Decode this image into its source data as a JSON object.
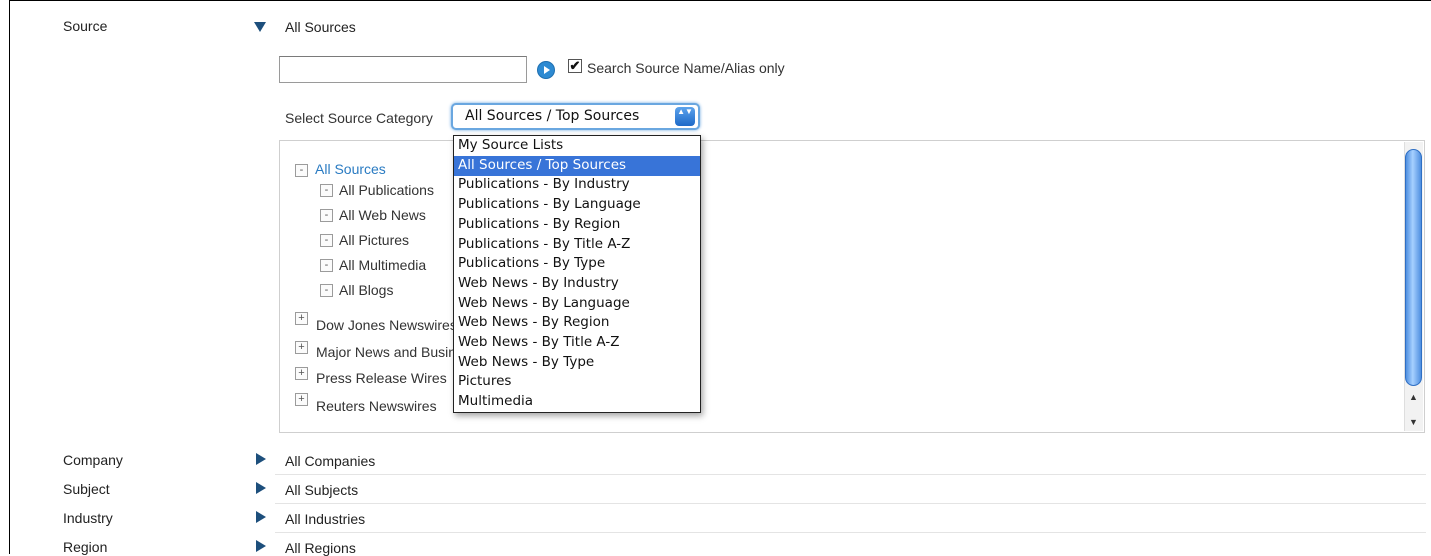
{
  "source": {
    "label": "Source",
    "value": "All Sources",
    "search_value": "",
    "checkbox_label": "Search Source Name/Alias only",
    "checkbox_mark": "✔",
    "category_label": "Select Source Category",
    "category_selected": "All Sources / Top Sources",
    "select_arrows": "▲▼",
    "tree": {
      "root": "All Sources",
      "children": [
        "All Publications",
        "All Web News",
        "All Pictures",
        "All Multimedia",
        "All Blogs"
      ],
      "groups": [
        "Dow Jones Newswires",
        "Major News and Business",
        "Press Release Wires",
        "Reuters Newswires"
      ]
    },
    "collapse_glyph": "-",
    "expand_glyph": "+",
    "dropdown_options": [
      "My Source Lists",
      "All Sources / Top Sources",
      "Publications - By Industry",
      "Publications - By Language",
      "Publications - By Region",
      "Publications - By Title A-Z",
      "Publications - By Type",
      "Web News - By Industry",
      "Web News - By Language",
      "Web News - By Region",
      "Web News - By Title A-Z",
      "Web News - By Type",
      "Pictures",
      "Multimedia"
    ]
  },
  "rows": [
    {
      "label": "Company",
      "value": "All Companies"
    },
    {
      "label": "Subject",
      "value": "All Subjects"
    },
    {
      "label": "Industry",
      "value": "All Industries"
    },
    {
      "label": "Region",
      "value": "All Regions"
    }
  ],
  "scrollbar": {
    "up": "▲",
    "down": "▼"
  },
  "colors": {
    "accent": "#2a7bc2",
    "selected_option_bg": "#3874d8",
    "triangle": "#1d4f7c"
  }
}
